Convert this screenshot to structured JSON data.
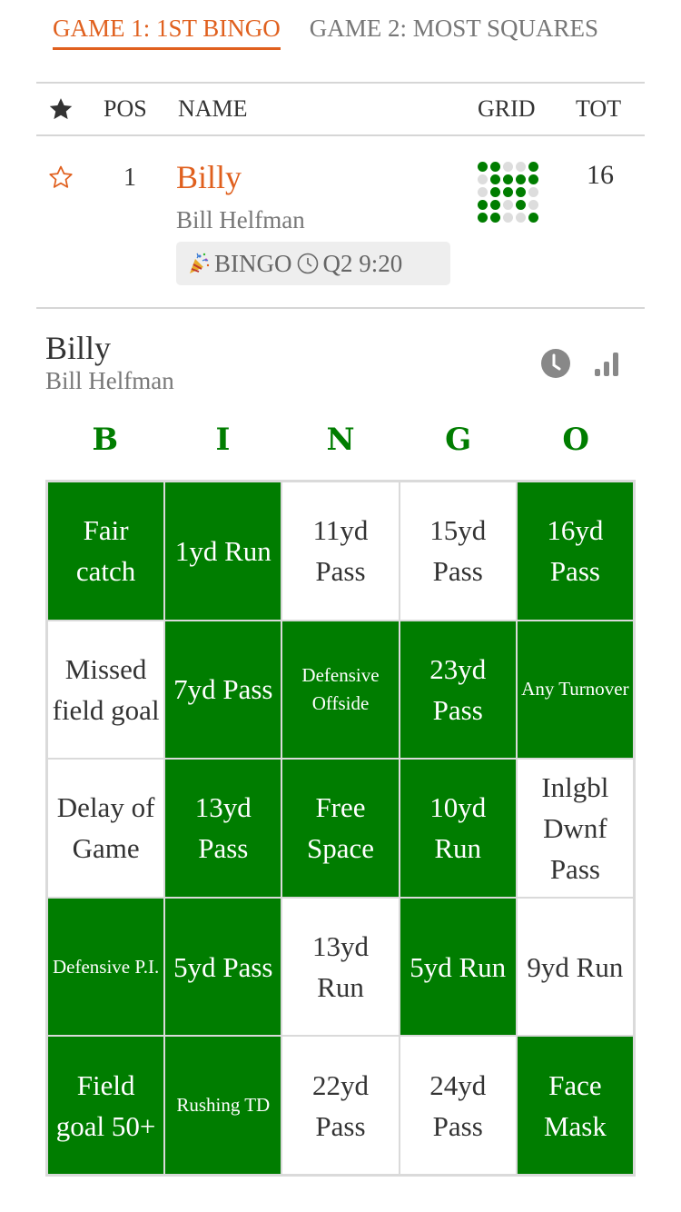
{
  "tabs": [
    {
      "label": "GAME 1: 1ST BINGO",
      "active": true
    },
    {
      "label": "GAME 2: MOST SQUARES",
      "active": false
    }
  ],
  "table_header": {
    "star_icon": "star-filled-icon",
    "pos": "POS",
    "name": "NAME",
    "grid": "GRID",
    "tot": "TOT"
  },
  "leaderboard": [
    {
      "favorite_icon": "star-outline-icon",
      "pos": "1",
      "nickname": "Billy",
      "full_name": "Bill Helfman",
      "badge": {
        "emoji_icon": "party-popper-icon",
        "label": "BINGO",
        "clock_icon": "clock-icon",
        "time": "Q2 9:20"
      },
      "grid_marks": [
        [
          1,
          1,
          0,
          0,
          1
        ],
        [
          0,
          1,
          1,
          1,
          1
        ],
        [
          0,
          1,
          1,
          1,
          0
        ],
        [
          1,
          1,
          0,
          1,
          0
        ],
        [
          1,
          1,
          0,
          0,
          1
        ]
      ],
      "tot": "16"
    }
  ],
  "player": {
    "nickname": "Billy",
    "full_name": "Bill Helfman",
    "icons": [
      "clock-icon",
      "bar-chart-icon"
    ]
  },
  "board": {
    "letters": [
      "B",
      "I",
      "N",
      "G",
      "O"
    ],
    "accent_color": "#007d00",
    "cells": [
      {
        "text": "Fair catch",
        "marked": true,
        "small": false
      },
      {
        "text": "1yd Run",
        "marked": true,
        "small": false
      },
      {
        "text": "11yd Pass",
        "marked": false,
        "small": false
      },
      {
        "text": "15yd Pass",
        "marked": false,
        "small": false
      },
      {
        "text": "16yd Pass",
        "marked": true,
        "small": false
      },
      {
        "text": "Missed field goal",
        "marked": false,
        "small": false
      },
      {
        "text": "7yd Pass",
        "marked": true,
        "small": false
      },
      {
        "text": "Defensive Offside",
        "marked": true,
        "small": true
      },
      {
        "text": "23yd Pass",
        "marked": true,
        "small": false
      },
      {
        "text": "Any Turnover",
        "marked": true,
        "small": true
      },
      {
        "text": "Delay of Game",
        "marked": false,
        "small": false
      },
      {
        "text": "13yd Pass",
        "marked": true,
        "small": false
      },
      {
        "text": "Free Space",
        "marked": true,
        "small": false
      },
      {
        "text": "10yd Run",
        "marked": true,
        "small": false
      },
      {
        "text": "Inlgbl Dwnf Pass",
        "marked": false,
        "small": false
      },
      {
        "text": "Defensive P.I.",
        "marked": true,
        "small": true
      },
      {
        "text": "5yd Pass",
        "marked": true,
        "small": false
      },
      {
        "text": "13yd Run",
        "marked": false,
        "small": false
      },
      {
        "text": "5yd Run",
        "marked": true,
        "small": false
      },
      {
        "text": "9yd Run",
        "marked": false,
        "small": false
      },
      {
        "text": "Field goal 50+",
        "marked": true,
        "small": false
      },
      {
        "text": "Rushing TD",
        "marked": true,
        "small": true
      },
      {
        "text": "22yd Pass",
        "marked": false,
        "small": false
      },
      {
        "text": "24yd Pass",
        "marked": false,
        "small": false
      },
      {
        "text": "Face Mask",
        "marked": true,
        "small": false
      }
    ]
  }
}
